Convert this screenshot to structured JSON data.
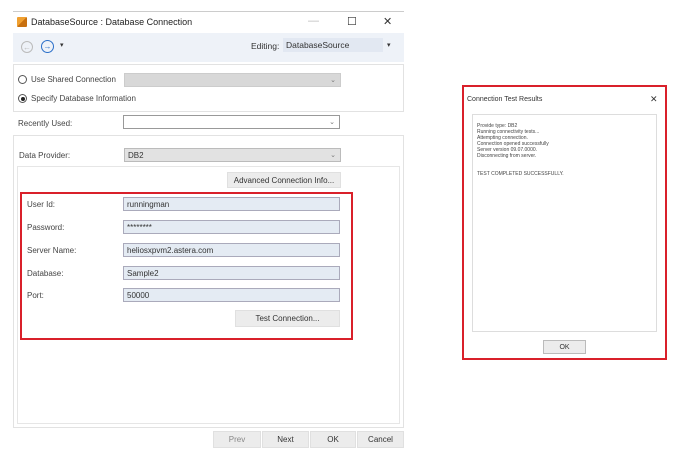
{
  "main_dialog": {
    "title": "DatabaseSource : Database Connection",
    "window_controls": {
      "minimize": "—",
      "maximize": "☐",
      "close": "✕"
    },
    "toolbar": {
      "editing_label": "Editing:",
      "editing_value": "DatabaseSource"
    },
    "options": {
      "use_shared": "Use Shared Connection",
      "specify": "Specify Database Information",
      "selected": "specify"
    },
    "recently_used_label": "Recently Used:",
    "recently_used_value": "",
    "data_provider_label": "Data Provider:",
    "data_provider_value": "DB2",
    "advanced_button": "Advanced Connection Info...",
    "fields": [
      {
        "label": "User Id:",
        "value": "runningman"
      },
      {
        "label": "Password:",
        "value": "********"
      },
      {
        "label": "Server Name:",
        "value": "heliosxpvm2.astera.com"
      },
      {
        "label": "Database:",
        "value": "Sample2"
      },
      {
        "label": "Port:",
        "value": "50000"
      }
    ],
    "test_button": "Test Connection...",
    "footer": {
      "prev": "Prev",
      "next": "Next",
      "ok": "OK",
      "cancel": "Cancel"
    }
  },
  "results_dialog": {
    "title": "Connection Test Results",
    "close": "✕",
    "lines": [
      "Provide type: DB2",
      "Running connectivity tests...",
      "Attempting connection.",
      "Connection opened successfully",
      "Server version 09.07.0000.",
      "Disconnecting from server."
    ],
    "result": "TEST COMPLETED SUCCESSFULLY.",
    "ok": "OK"
  },
  "colors": {
    "highlight": "#d9202a",
    "toolbar": "#eef2f8",
    "field": "#e4ebf3"
  }
}
